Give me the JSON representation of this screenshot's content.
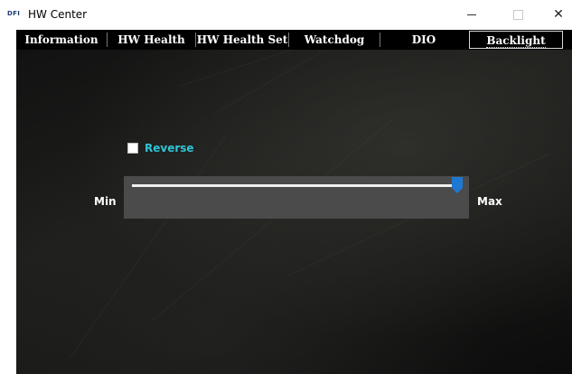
{
  "window": {
    "logo_text": "DFI",
    "title": "HW Center",
    "controls": {
      "minimize": "minimize",
      "maximize": "maximize",
      "close": "✕"
    }
  },
  "tabs": [
    {
      "label": "Information",
      "active": false
    },
    {
      "label": "HW Health",
      "active": false
    },
    {
      "label": "HW Health Set",
      "active": false
    },
    {
      "label": "Watchdog",
      "active": false
    },
    {
      "label": "DIO",
      "active": false
    },
    {
      "label": "Backlight",
      "active": true
    }
  ],
  "backlight": {
    "reverse_label": "Reverse",
    "reverse_checked": false,
    "min_label": "Min",
    "max_label": "Max",
    "slider_fraction": 1.0
  },
  "colors": {
    "accent": "#2ec4d6",
    "thumb": "#1e78d2",
    "tab_bg": "#000000",
    "slider_bg": "#4b4b4b"
  }
}
